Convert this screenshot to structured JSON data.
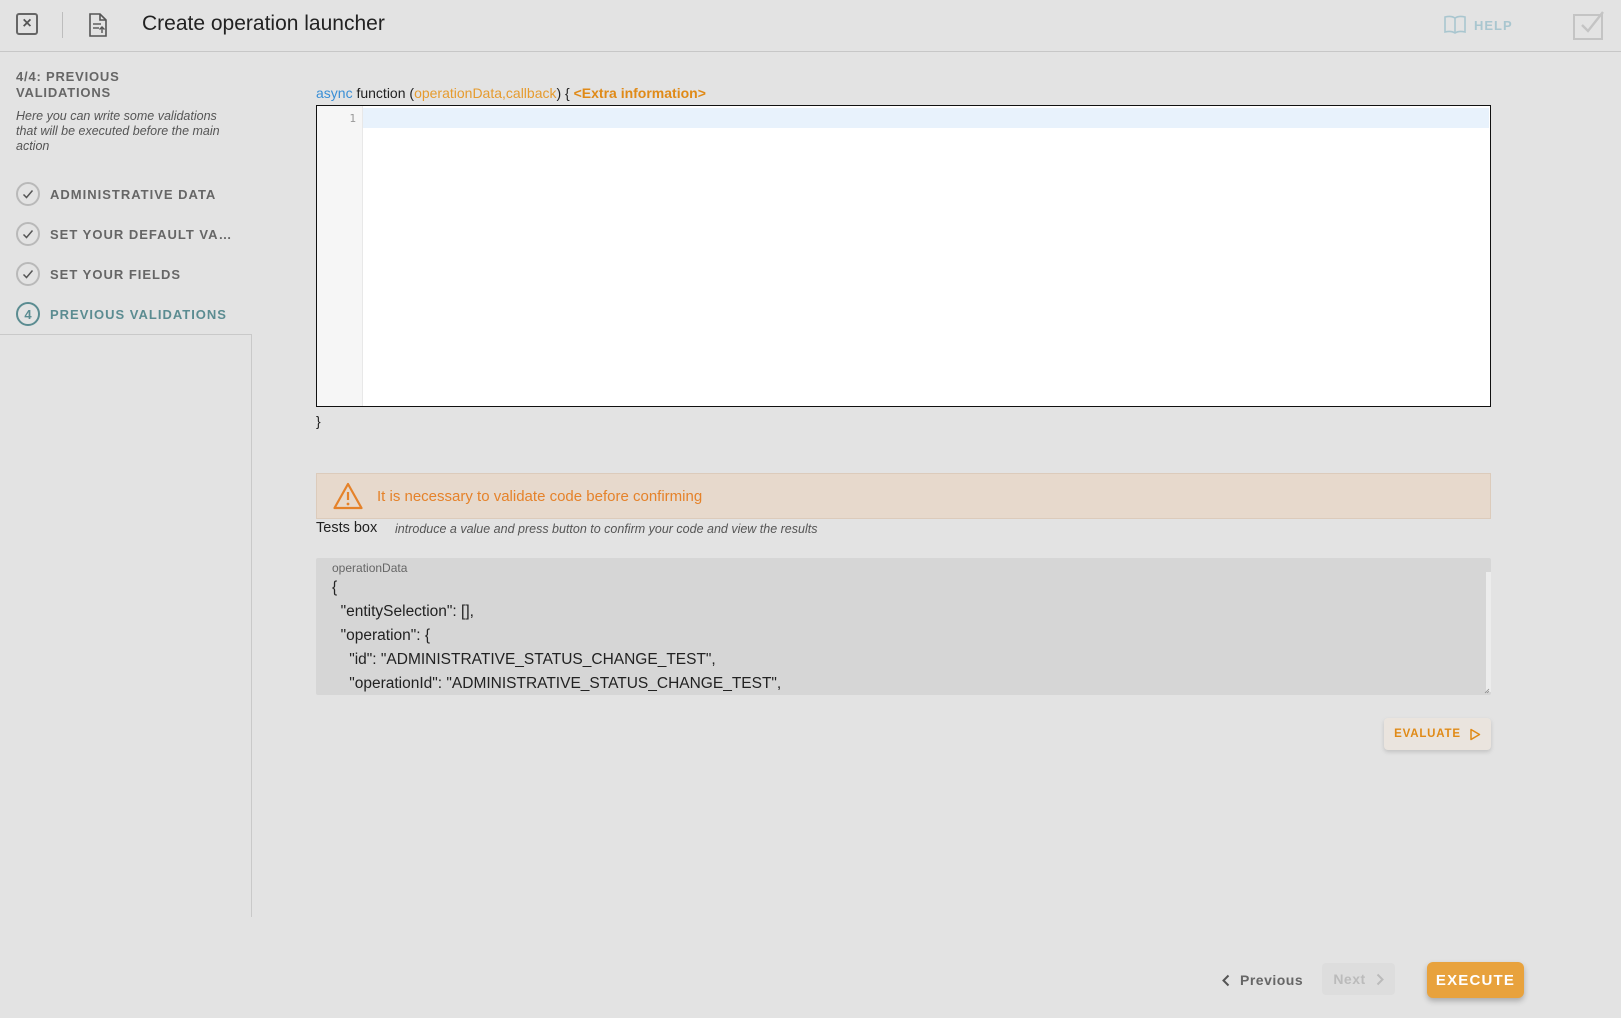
{
  "header": {
    "title": "Create operation launcher",
    "help_label": "HELP"
  },
  "sidebar": {
    "step_heading": "4/4: PREVIOUS VALIDATIONS",
    "step_description": "Here you can write some validations that will be executed before the main action",
    "steps": [
      {
        "label": "ADMINISTRATIVE DATA",
        "status": "done"
      },
      {
        "label": "SET YOUR DEFAULT VALUES",
        "status": "done"
      },
      {
        "label": "SET YOUR FIELDS",
        "status": "done"
      },
      {
        "label": "PREVIOUS VALIDATIONS",
        "status": "active",
        "number": "4"
      }
    ]
  },
  "editor": {
    "signature_keyword": "async",
    "signature_function": " function (",
    "signature_params": "operationData,callback",
    "signature_close": ") { ",
    "extra_info": "<Extra information>",
    "line_number": "1",
    "closing_brace": "}"
  },
  "warning": {
    "text": "It is necessary to validate code before confirming"
  },
  "tests": {
    "label": "Tests box",
    "hint": "introduce a value and press button to confirm your code and view the results",
    "area_label": "operationData",
    "code": "{\n  \"entitySelection\": [],\n  \"operation\": {\n    \"id\": \"ADMINISTRATIVE_STATUS_CHANGE_TEST\",\n    \"operationId\": \"ADMINISTRATIVE_STATUS_CHANGE_TEST\","
  },
  "buttons": {
    "evaluate": "EVALUATE",
    "previous": "Previous",
    "next": "Next",
    "execute": "EXECUTE"
  },
  "colors": {
    "accent": "#e8a23d",
    "warning_text": "#e5822a",
    "active_step": "#5b8c91",
    "keyword": "#3a8fd6"
  }
}
